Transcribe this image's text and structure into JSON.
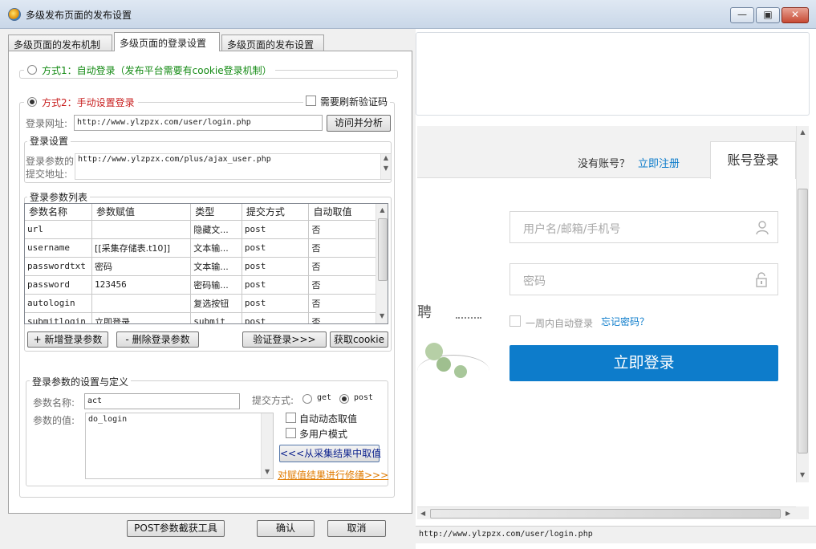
{
  "window": {
    "title": "多级发布页面的发布设置",
    "min_symbol": "—",
    "max_symbol": "▣",
    "close_symbol": "✕"
  },
  "tabs": [
    {
      "label": "多级页面的发布机制"
    },
    {
      "label": "多级页面的登录设置"
    },
    {
      "label": "多级页面的发布设置"
    }
  ],
  "mode1": {
    "label": "方式1：自动登录（发布平台需要有cookie登录机制）",
    "selected": false,
    "color": "#138a13"
  },
  "mode2": {
    "label": "方式2：手动设置登录",
    "selected": true,
    "color": "#c81e1e",
    "refresh_captcha_label": "需要刷新验证码",
    "login_url_label": "登录网址:",
    "login_url_value": "http://www.ylzpzx.com/user/login.php",
    "visit_button": "访问并分析"
  },
  "login_settings": {
    "group_title": "登录设置",
    "submit_label_line1": "登录参数的",
    "submit_label_line2": "提交地址:",
    "submit_url": "http://www.ylzpzx.com/plus/ajax_user.php"
  },
  "param_list": {
    "group_title": "登录参数列表",
    "columns": [
      "参数名称",
      "参数赋值",
      "类型",
      "提交方式",
      "自动取值"
    ],
    "rows": [
      {
        "name": "url",
        "value": "",
        "type": "隐藏文...",
        "method": "post",
        "auto": "否"
      },
      {
        "name": "username",
        "value": "[[采集存储表.t10]]",
        "type": "文本输...",
        "method": "post",
        "auto": "否"
      },
      {
        "name": "passwordtxt",
        "value": "密码",
        "type": "文本输...",
        "method": "post",
        "auto": "否"
      },
      {
        "name": "password",
        "value": "123456",
        "type": "密码输...",
        "method": "post",
        "auto": "否"
      },
      {
        "name": "autologin",
        "value": "",
        "type": "复选按钮",
        "method": "post",
        "auto": "否"
      },
      {
        "name": "submitlogin",
        "value": "立即登录",
        "type": "submit",
        "method": "post",
        "auto": "否"
      }
    ],
    "add_button": "+ 新增登录参数",
    "delete_button": "- 删除登录参数",
    "verify_button": "验证登录>>>",
    "cookie_button": "获取cookie"
  },
  "param_def": {
    "group_title": "登录参数的设置与定义",
    "name_label": "参数名称:",
    "name_value": "act",
    "method_label": "提交方式:",
    "method_get": "get",
    "method_post": "post",
    "method_selected": "post",
    "value_label": "参数的值:",
    "value_text": "do_login",
    "auto_dynamic_label": "自动动态取值",
    "multi_user_label": "多用户模式",
    "from_collect_button": "<<<从采集结果中取值",
    "modify_link": "对赋值结果进行修缮>>>"
  },
  "bottom_buttons": {
    "post_tool": "POST参数截获工具",
    "ok": "确认",
    "cancel": "取消"
  },
  "browser": {
    "no_account": "没有账号？",
    "register": "立即注册",
    "login_tab": "账号登录",
    "username_placeholder": "用户名/邮箱/手机号",
    "password_placeholder": "密码",
    "remember_label": "一周内自动登录",
    "forgot_link": "忘记密码？",
    "login_button": "立即登录",
    "bg_char": "聘",
    "accent": "#0d7ccb",
    "status_url": "http://www.ylzpzx.com/user/login.php"
  }
}
